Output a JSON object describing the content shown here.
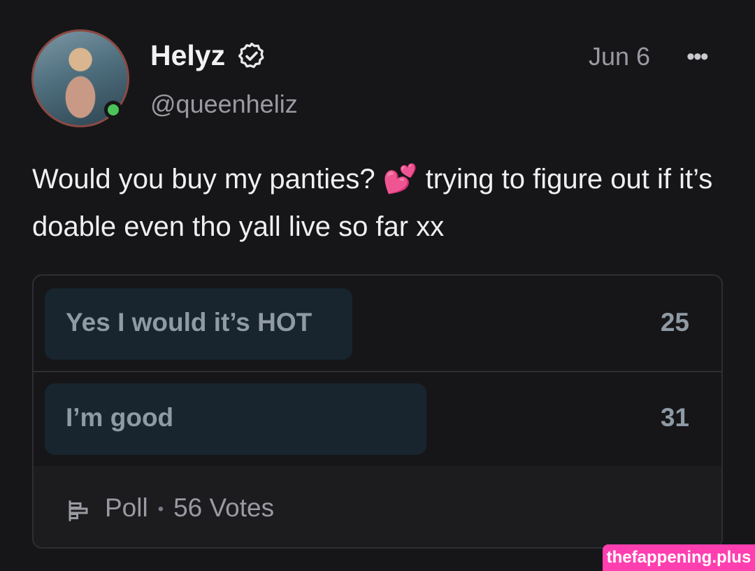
{
  "author": {
    "name": "Helyz",
    "handle": "@queenheliz",
    "verified": true,
    "online": true
  },
  "post": {
    "date": "Jun 6",
    "text_part1": "Would you buy my panties? ",
    "emoji": "💕",
    "text_part2": " trying to figure out if it’s doable even tho yall live so far xx"
  },
  "poll": {
    "options": [
      {
        "label": "Yes I would it’s HOT",
        "votes": "25",
        "share": 0.446
      },
      {
        "label": "I’m good",
        "votes": "31",
        "share": 0.554
      }
    ],
    "type_label": "Poll",
    "separator": "•",
    "total_label": "56 Votes"
  },
  "icons": {
    "more": "more-horizontal-icon",
    "verified": "verified-badge-icon",
    "poll": "poll-icon"
  },
  "watermark": "thefappening.plus"
}
